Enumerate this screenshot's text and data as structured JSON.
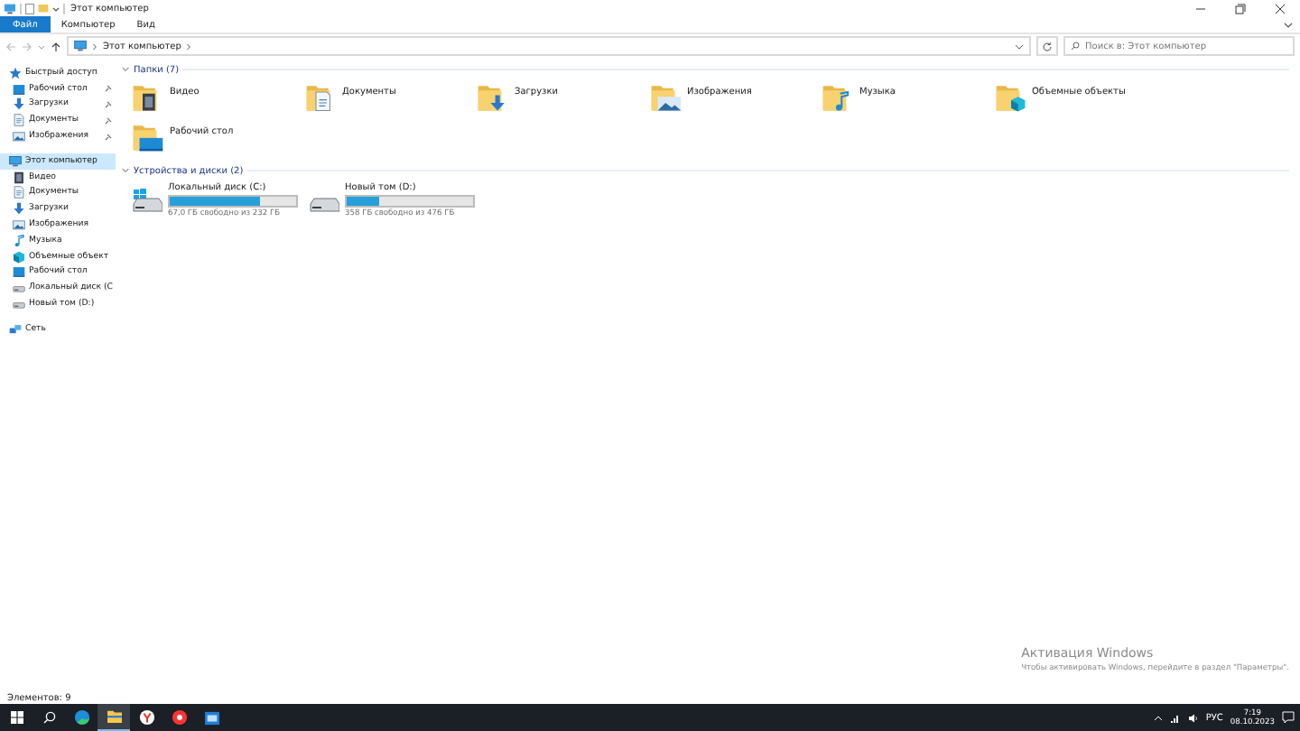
{
  "window": {
    "title": "Этот компьютер"
  },
  "ribbon_tabs": [
    {
      "label": "Файл",
      "kind": "file",
      "selected": false
    },
    {
      "label": "Компьютер",
      "kind": "tab",
      "selected": false
    },
    {
      "label": "Вид",
      "kind": "tab",
      "selected": false
    }
  ],
  "address_bar": {
    "path": "Этот компьютер",
    "search_placeholder": "Поиск в: Этот компьютер"
  },
  "sidebar": {
    "items": [
      {
        "label": "Быстрый доступ",
        "kind": "star",
        "selected": false,
        "children": [
          {
            "label": "Рабочий стол",
            "kind": "desktop",
            "pinned": true,
            "selected": false
          },
          {
            "label": "Загрузки",
            "kind": "download",
            "pinned": true,
            "selected": false
          },
          {
            "label": "Документы",
            "kind": "document",
            "pinned": true,
            "selected": false
          },
          {
            "label": "Изображения",
            "kind": "image",
            "pinned": true,
            "selected": false
          }
        ]
      },
      {
        "label": "Этот компьютер",
        "kind": "pc",
        "selected": true,
        "children": [
          {
            "label": "Видео",
            "kind": "video",
            "pinned": false,
            "selected": false
          },
          {
            "label": "Документы",
            "kind": "document",
            "pinned": false,
            "selected": false
          },
          {
            "label": "Загрузки",
            "kind": "download",
            "pinned": false,
            "selected": false
          },
          {
            "label": "Изображения",
            "kind": "image",
            "pinned": false,
            "selected": false
          },
          {
            "label": "Музыка",
            "kind": "music",
            "pinned": false,
            "selected": false
          },
          {
            "label": "Объемные объект",
            "kind": "cube",
            "pinned": false,
            "selected": false
          },
          {
            "label": "Рабочий стол",
            "kind": "desktop",
            "pinned": false,
            "selected": false
          },
          {
            "label": "Локальный диск (C",
            "kind": "drive",
            "pinned": false,
            "selected": false
          },
          {
            "label": "Новый том (D:)",
            "kind": "drive",
            "pinned": false,
            "selected": false
          }
        ]
      },
      {
        "label": "Сеть",
        "kind": "network",
        "selected": false
      }
    ]
  },
  "folders": {
    "title": "Папки (7)",
    "expanded": true,
    "items": [
      {
        "label": "Видео",
        "kind": "video"
      },
      {
        "label": "Документы",
        "kind": "document"
      },
      {
        "label": "Загрузки",
        "kind": "download"
      },
      {
        "label": "Изображения",
        "kind": "image"
      },
      {
        "label": "Музыка",
        "kind": "music"
      },
      {
        "label": "Объемные объекты",
        "kind": "cube"
      },
      {
        "label": "Рабочий стол",
        "kind": "desktop"
      }
    ]
  },
  "drives": {
    "title": "Устройства и диски (2)",
    "expanded": true,
    "items": [
      {
        "label": "Локальный диск (C:)",
        "system": true,
        "level": 0.71,
        "free": "67,0 ГБ свободно из 232 ГБ"
      },
      {
        "label": "Новый том (D:)",
        "system": false,
        "level": 0.25,
        "free": "358 ГБ свободно из 476 ГБ"
      }
    ]
  },
  "activation": {
    "title": "Активация Windows",
    "text": "Чтобы активировать Windows, перейдите в раздел \"Параметры\"."
  },
  "status_bar": {
    "count": "Элементов: 9"
  },
  "taskbar": {
    "apps": [
      {
        "kind": "edge",
        "selected": false
      },
      {
        "kind": "explorer",
        "selected": true
      },
      {
        "kind": "yabrowser",
        "selected": false
      },
      {
        "kind": "yandex",
        "selected": false
      },
      {
        "kind": "app",
        "selected": false
      }
    ],
    "language": "РУС",
    "time": "7:19",
    "date": "08.10.2023"
  }
}
